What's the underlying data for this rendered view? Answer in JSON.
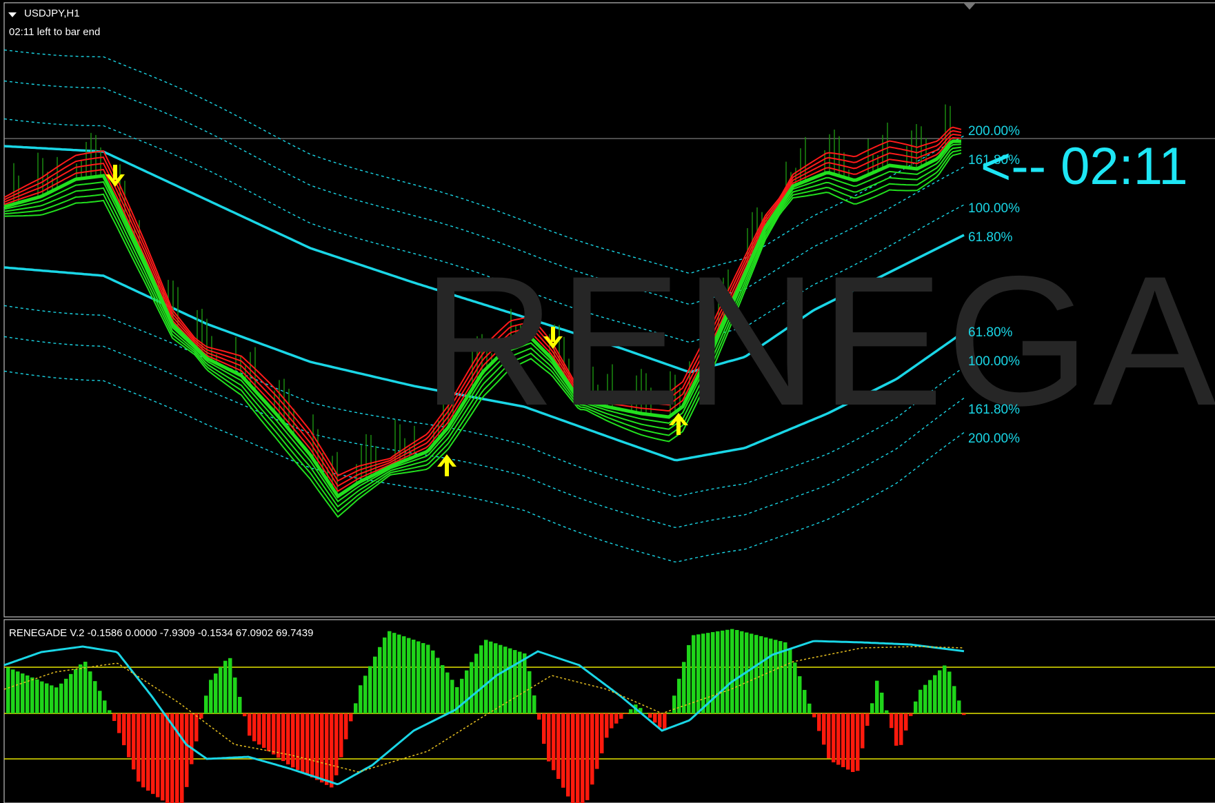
{
  "main_chart": {
    "symbol_timeframe": "USDJPY,H1",
    "countdown_text": "02:11 left to bar end",
    "timer_label": "<-- 02:11",
    "watermark": "RENEGAI",
    "level_labels": [
      "200.00%",
      "161.80%",
      "100.00%",
      "61.80%",
      "61.80%",
      "100.00%",
      "161.80%",
      "200.00%"
    ],
    "signals": [
      {
        "direction": "down",
        "color": "#ffff00"
      },
      {
        "direction": "up",
        "color": "#ffff00"
      },
      {
        "direction": "down",
        "color": "#ffff00"
      },
      {
        "direction": "up",
        "color": "#ffff00"
      }
    ],
    "colors": {
      "background": "#000000",
      "band_cyan": "#1ad6e6",
      "ribbon_green": "#22e01e",
      "ribbon_red": "#ff1a1a",
      "volume_bar": "#1a8a10",
      "arrow": "#ffff00"
    }
  },
  "indicator_pane": {
    "title": "RENEGADE V.2 -0.1586 0.0000 -7.9309 -0.1534 67.0902 69.7439",
    "colors": {
      "positive_bar": "#1fd41a",
      "negative_bar": "#ff1a0d",
      "signal_line": "#1ad6e6",
      "dotted_line": "#e8c020",
      "level_line": "#e6e600"
    }
  }
}
